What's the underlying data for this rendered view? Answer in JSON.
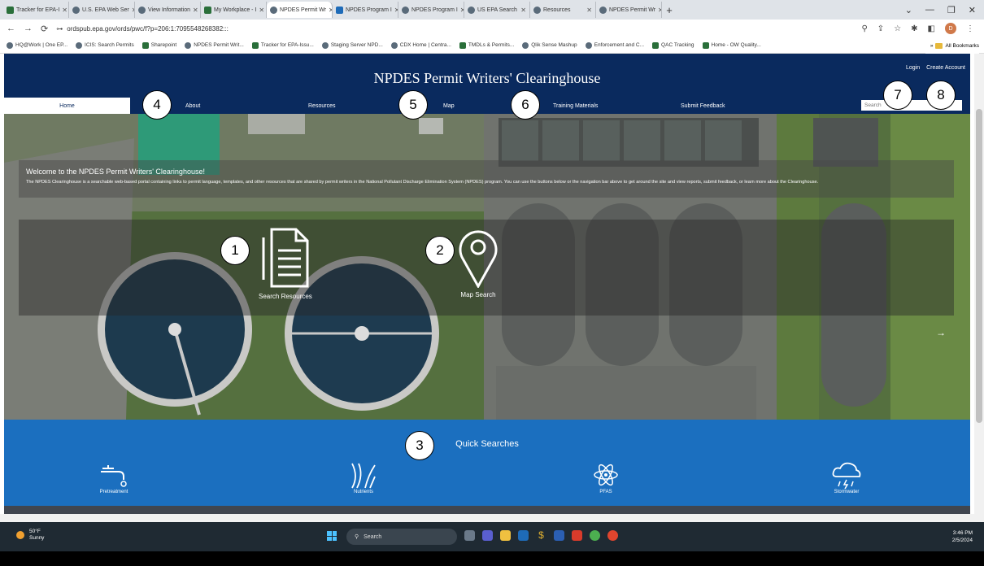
{
  "browser": {
    "tabs": [
      {
        "label": "Tracker for EPA-I"
      },
      {
        "label": "U.S. EPA Web Ser"
      },
      {
        "label": "View Information"
      },
      {
        "label": "My Workplace - I"
      },
      {
        "label": "NPDES Permit Wr"
      },
      {
        "label": "NPDES Program I"
      },
      {
        "label": "NPDES Program I"
      },
      {
        "label": "US EPA Search"
      },
      {
        "label": "Resources"
      },
      {
        "label": "NPDES Permit Wr"
      }
    ],
    "url": "ordspub.epa.gov/ords/pwc/f?p=206:1:7095548268382:::",
    "profile_initial": "D",
    "bookmarks": [
      {
        "label": "HQ@Work | One EP..."
      },
      {
        "label": "ICIS: Search Permits"
      },
      {
        "label": "Sharepoint"
      },
      {
        "label": "NPDES Permit Writ..."
      },
      {
        "label": "Tracker for EPA-Issu..."
      },
      {
        "label": "Staging Server NPD..."
      },
      {
        "label": "CDX Home | Centra..."
      },
      {
        "label": "TMDLs & Permits..."
      },
      {
        "label": "Qlik Sense Mashup"
      },
      {
        "label": "Enforcement and C..."
      },
      {
        "label": "QAC Tracking"
      },
      {
        "label": "Home - OW Quality..."
      }
    ],
    "all_bookmarks": "All Bookmarks"
  },
  "site": {
    "title": "NPDES Permit Writers' Clearinghouse",
    "login": "Login",
    "create_account": "Create Account",
    "nav": {
      "home": "Home",
      "about": "About",
      "resources": "Resources",
      "map": "Map",
      "training": "Training Materials",
      "feedback": "Submit Feedback"
    },
    "search_placeholder": "Search",
    "welcome_title": "Welcome to the NPDES Permit Writers' Clearinghouse!",
    "welcome_text": "The NPDES Clearinghouse is a searchable web-based portal containing links to permit language, templates, and other resources that are shared by permit writers in the National Pollutant Discharge Elimination System (NPDES) program. You can use the buttons below or the navigation bar above to get around the site and view reports, submit feedback, or learn more about the Clearinghouse.",
    "actions": {
      "search_resources": "Search Resources",
      "map_search": "Map Search"
    },
    "quick_searches": {
      "title": "Quick Searches",
      "items": [
        {
          "label": "Pretreatment",
          "icon": "faucet-icon"
        },
        {
          "label": "Nutrients",
          "icon": "plant-icon"
        },
        {
          "label": "PFAS",
          "icon": "atom-icon"
        },
        {
          "label": "Stormwater",
          "icon": "storm-cloud-icon"
        }
      ]
    }
  },
  "callouts": [
    "1",
    "2",
    "3",
    "4",
    "5",
    "6",
    "7",
    "8"
  ],
  "taskbar": {
    "temperature": "50°F",
    "condition": "Sunny",
    "search_label": "Search",
    "time": "3:46 PM",
    "date": "2/5/2024"
  }
}
